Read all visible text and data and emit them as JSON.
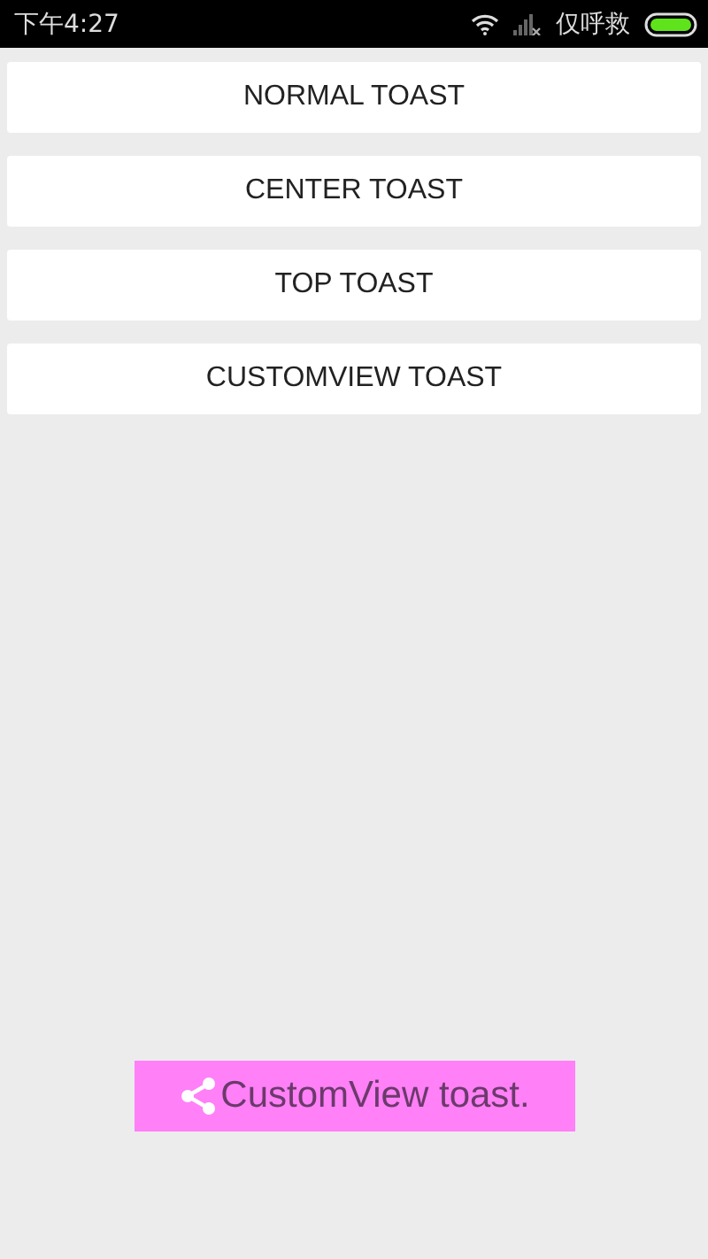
{
  "status_bar": {
    "time": "下午4:27",
    "carrier": "仅呼救"
  },
  "buttons": [
    {
      "label": "NORMAL TOAST"
    },
    {
      "label": "CENTER TOAST"
    },
    {
      "label": "TOP TOAST"
    },
    {
      "label": "CUSTOMVIEW TOAST"
    }
  ],
  "toast": {
    "text": "CustomView toast."
  }
}
